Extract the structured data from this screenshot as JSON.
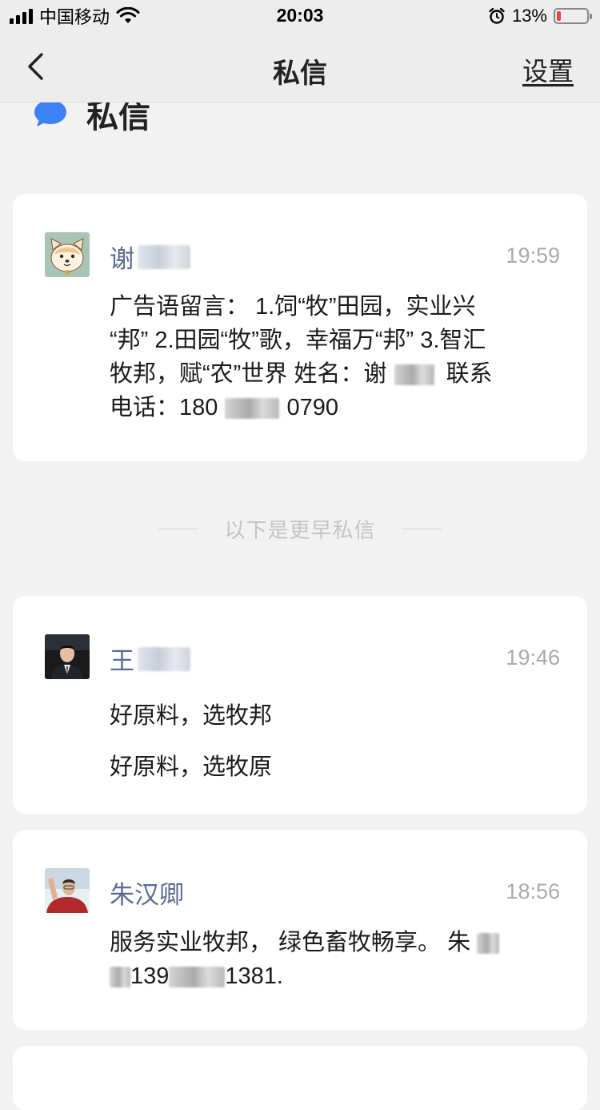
{
  "status_bar": {
    "carrier": "中国移动",
    "time": "20:03",
    "battery": "13%",
    "battery_level": 0.13,
    "icons": [
      "signal-icon",
      "wifi-icon",
      "alarm-icon",
      "battery-icon"
    ]
  },
  "nav": {
    "title": "私信",
    "settings_label": "设置",
    "back_icon": "chevron-left-icon"
  },
  "section": {
    "title": "私信",
    "icon": "chat-bubble-icon",
    "accent_color": "#3b82f6"
  },
  "messages": [
    {
      "name": "谢",
      "time": "19:59",
      "lines": [
        "广告语留言： 1.饲“牧”田园，实业兴",
        "“邦” 2.田园“牧”歌，幸福万“邦” 3.智汇",
        "牧邦，赋“农”世界 姓名：谢",
        "联系",
        "电话：180",
        "0790"
      ]
    },
    {
      "name": "王",
      "time": "19:46",
      "lines": [
        "好原料，选牧邦",
        "好原料，选牧原"
      ]
    },
    {
      "name": "朱汉卿",
      "time": "18:56",
      "lines": [
        "服务实业牧邦， 绿色畜牧畅享。 朱",
        "139",
        "1381."
      ]
    }
  ],
  "divider_text": "以下是更早私信",
  "colors": {
    "name_color": "#5a6b94",
    "time_color": "#aaaaaa",
    "background": "#f2f2f2"
  }
}
